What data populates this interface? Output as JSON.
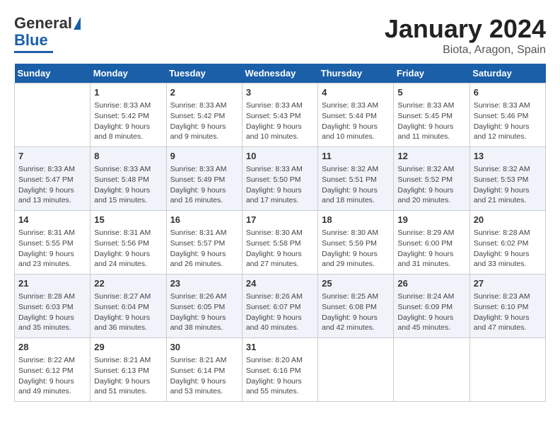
{
  "header": {
    "logo_line1": "General",
    "logo_line2": "Blue",
    "title": "January 2024",
    "subtitle": "Biota, Aragon, Spain"
  },
  "days_of_week": [
    "Sunday",
    "Monday",
    "Tuesday",
    "Wednesday",
    "Thursday",
    "Friday",
    "Saturday"
  ],
  "weeks": [
    [
      {
        "day": "",
        "info": ""
      },
      {
        "day": "1",
        "info": "Sunrise: 8:33 AM\nSunset: 5:42 PM\nDaylight: 9 hours\nand 8 minutes."
      },
      {
        "day": "2",
        "info": "Sunrise: 8:33 AM\nSunset: 5:42 PM\nDaylight: 9 hours\nand 9 minutes."
      },
      {
        "day": "3",
        "info": "Sunrise: 8:33 AM\nSunset: 5:43 PM\nDaylight: 9 hours\nand 10 minutes."
      },
      {
        "day": "4",
        "info": "Sunrise: 8:33 AM\nSunset: 5:44 PM\nDaylight: 9 hours\nand 10 minutes."
      },
      {
        "day": "5",
        "info": "Sunrise: 8:33 AM\nSunset: 5:45 PM\nDaylight: 9 hours\nand 11 minutes."
      },
      {
        "day": "6",
        "info": "Sunrise: 8:33 AM\nSunset: 5:46 PM\nDaylight: 9 hours\nand 12 minutes."
      }
    ],
    [
      {
        "day": "7",
        "info": "Sunrise: 8:33 AM\nSunset: 5:47 PM\nDaylight: 9 hours\nand 13 minutes."
      },
      {
        "day": "8",
        "info": "Sunrise: 8:33 AM\nSunset: 5:48 PM\nDaylight: 9 hours\nand 15 minutes."
      },
      {
        "day": "9",
        "info": "Sunrise: 8:33 AM\nSunset: 5:49 PM\nDaylight: 9 hours\nand 16 minutes."
      },
      {
        "day": "10",
        "info": "Sunrise: 8:33 AM\nSunset: 5:50 PM\nDaylight: 9 hours\nand 17 minutes."
      },
      {
        "day": "11",
        "info": "Sunrise: 8:32 AM\nSunset: 5:51 PM\nDaylight: 9 hours\nand 18 minutes."
      },
      {
        "day": "12",
        "info": "Sunrise: 8:32 AM\nSunset: 5:52 PM\nDaylight: 9 hours\nand 20 minutes."
      },
      {
        "day": "13",
        "info": "Sunrise: 8:32 AM\nSunset: 5:53 PM\nDaylight: 9 hours\nand 21 minutes."
      }
    ],
    [
      {
        "day": "14",
        "info": "Sunrise: 8:31 AM\nSunset: 5:55 PM\nDaylight: 9 hours\nand 23 minutes."
      },
      {
        "day": "15",
        "info": "Sunrise: 8:31 AM\nSunset: 5:56 PM\nDaylight: 9 hours\nand 24 minutes."
      },
      {
        "day": "16",
        "info": "Sunrise: 8:31 AM\nSunset: 5:57 PM\nDaylight: 9 hours\nand 26 minutes."
      },
      {
        "day": "17",
        "info": "Sunrise: 8:30 AM\nSunset: 5:58 PM\nDaylight: 9 hours\nand 27 minutes."
      },
      {
        "day": "18",
        "info": "Sunrise: 8:30 AM\nSunset: 5:59 PM\nDaylight: 9 hours\nand 29 minutes."
      },
      {
        "day": "19",
        "info": "Sunrise: 8:29 AM\nSunset: 6:00 PM\nDaylight: 9 hours\nand 31 minutes."
      },
      {
        "day": "20",
        "info": "Sunrise: 8:28 AM\nSunset: 6:02 PM\nDaylight: 9 hours\nand 33 minutes."
      }
    ],
    [
      {
        "day": "21",
        "info": "Sunrise: 8:28 AM\nSunset: 6:03 PM\nDaylight: 9 hours\nand 35 minutes."
      },
      {
        "day": "22",
        "info": "Sunrise: 8:27 AM\nSunset: 6:04 PM\nDaylight: 9 hours\nand 36 minutes."
      },
      {
        "day": "23",
        "info": "Sunrise: 8:26 AM\nSunset: 6:05 PM\nDaylight: 9 hours\nand 38 minutes."
      },
      {
        "day": "24",
        "info": "Sunrise: 8:26 AM\nSunset: 6:07 PM\nDaylight: 9 hours\nand 40 minutes."
      },
      {
        "day": "25",
        "info": "Sunrise: 8:25 AM\nSunset: 6:08 PM\nDaylight: 9 hours\nand 42 minutes."
      },
      {
        "day": "26",
        "info": "Sunrise: 8:24 AM\nSunset: 6:09 PM\nDaylight: 9 hours\nand 45 minutes."
      },
      {
        "day": "27",
        "info": "Sunrise: 8:23 AM\nSunset: 6:10 PM\nDaylight: 9 hours\nand 47 minutes."
      }
    ],
    [
      {
        "day": "28",
        "info": "Sunrise: 8:22 AM\nSunset: 6:12 PM\nDaylight: 9 hours\nand 49 minutes."
      },
      {
        "day": "29",
        "info": "Sunrise: 8:21 AM\nSunset: 6:13 PM\nDaylight: 9 hours\nand 51 minutes."
      },
      {
        "day": "30",
        "info": "Sunrise: 8:21 AM\nSunset: 6:14 PM\nDaylight: 9 hours\nand 53 minutes."
      },
      {
        "day": "31",
        "info": "Sunrise: 8:20 AM\nSunset: 6:16 PM\nDaylight: 9 hours\nand 55 minutes."
      },
      {
        "day": "",
        "info": ""
      },
      {
        "day": "",
        "info": ""
      },
      {
        "day": "",
        "info": ""
      }
    ]
  ]
}
